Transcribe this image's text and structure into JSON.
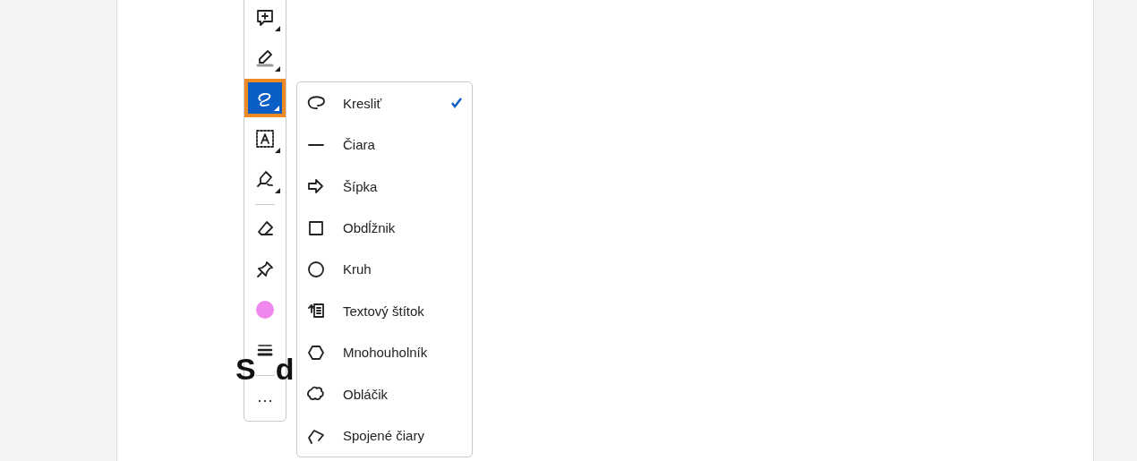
{
  "document": {
    "heading_parts": [
      "S",
      "d"
    ]
  },
  "toolbar": {
    "tools": [
      {
        "kind": "comment",
        "selected": false,
        "submenu": true
      },
      {
        "kind": "highlight",
        "selected": false,
        "submenu": true
      },
      {
        "kind": "draw",
        "selected": true,
        "submenu": true
      },
      {
        "kind": "textbox",
        "selected": false,
        "submenu": true
      },
      {
        "kind": "sign",
        "selected": false,
        "submenu": true
      },
      {
        "kind": "divider"
      },
      {
        "kind": "eraser",
        "selected": false,
        "submenu": false
      },
      {
        "kind": "pin",
        "selected": false,
        "submenu": false
      },
      {
        "kind": "color",
        "selected": false,
        "submenu": false,
        "color": "#ee88ee"
      },
      {
        "kind": "weight",
        "selected": false,
        "submenu": false
      },
      {
        "kind": "divider"
      },
      {
        "kind": "more",
        "selected": false,
        "submenu": false,
        "label": "···"
      }
    ]
  },
  "menu": {
    "items": [
      {
        "kind": "freehand",
        "label": "Kresliť",
        "selected": true
      },
      {
        "kind": "line",
        "label": "Čiara",
        "selected": false
      },
      {
        "kind": "arrow",
        "label": "Šípka",
        "selected": false
      },
      {
        "kind": "rectangle",
        "label": "Obdĺžnik",
        "selected": false
      },
      {
        "kind": "circle",
        "label": "Kruh",
        "selected": false
      },
      {
        "kind": "callout",
        "label": "Textový štítok",
        "selected": false
      },
      {
        "kind": "polygon",
        "label": "Mnohouholník",
        "selected": false
      },
      {
        "kind": "cloud",
        "label": "Obláčik",
        "selected": false
      },
      {
        "kind": "polyline",
        "label": "Spojené čiary",
        "selected": false
      }
    ]
  }
}
